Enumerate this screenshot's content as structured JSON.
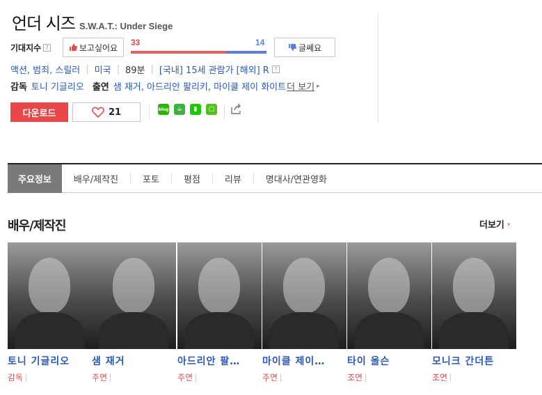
{
  "movie": {
    "title_ko": "언더 시즈",
    "title_en": "S.W.A.T.: Under Siege"
  },
  "expectation": {
    "label": "기대지수",
    "help_icon": "?",
    "want_label": "보고싶어요",
    "not_label": "글쎄요",
    "want_count": "33",
    "not_count": "14",
    "want_ratio": 0.702
  },
  "meta": {
    "genre": "액션, 범죄, 스릴러",
    "country": "미국",
    "runtime": "89분",
    "rating_domestic": "[국내] 15세 관람가",
    "rating_overseas": "[해외] R",
    "help_icon": "?"
  },
  "credits": {
    "director_label": "감독",
    "director": "토니 기글리오",
    "cast_label": "출연",
    "cast": "샘 재거, 아드리안 팔리키, 마이클 제이 화이트",
    "more_label": "더 보기",
    "more_arrow": "▸"
  },
  "actions": {
    "download_label": "다운로드",
    "like_icon": "heart-icon",
    "like_count": "21"
  },
  "share": {
    "items": [
      {
        "name": "blog-share-icon",
        "color": "#2db400",
        "label": "blog"
      },
      {
        "name": "cafe-share-icon",
        "color": "#3db03d",
        "label": "☕"
      },
      {
        "name": "bookmark-share-icon",
        "color": "#1ec800",
        "label": "▮"
      },
      {
        "name": "memo-share-icon",
        "color": "#54c01d",
        "label": "▢"
      }
    ],
    "share_icon": "share-icon"
  },
  "tabs": [
    {
      "label": "주요정보",
      "active": true
    },
    {
      "label": "배우/제작진",
      "active": false
    },
    {
      "label": "포토",
      "active": false
    },
    {
      "label": "평점",
      "active": false
    },
    {
      "label": "리뷰",
      "active": false
    },
    {
      "label": "명대사/연관영화",
      "active": false
    }
  ],
  "cast_section": {
    "title": "배우/제작진",
    "more_label": "더보기",
    "more_arrow": "›",
    "people": [
      {
        "name": "토니 기글리오",
        "role": "감독"
      },
      {
        "name": "샘 재거",
        "role": "주연"
      },
      {
        "name": "아드리안 팔…",
        "role": "주연"
      },
      {
        "name": "마이클 제이…",
        "role": "주연"
      },
      {
        "name": "타이 올슨",
        "role": "조연"
      },
      {
        "name": "모니크 간더튼",
        "role": "조연"
      }
    ]
  },
  "colors": {
    "accent_red": "#e84747",
    "link_blue": "#2a58b5",
    "bar_blue": "#5b7fd6",
    "tab_active_bg": "#7a7a7a"
  }
}
